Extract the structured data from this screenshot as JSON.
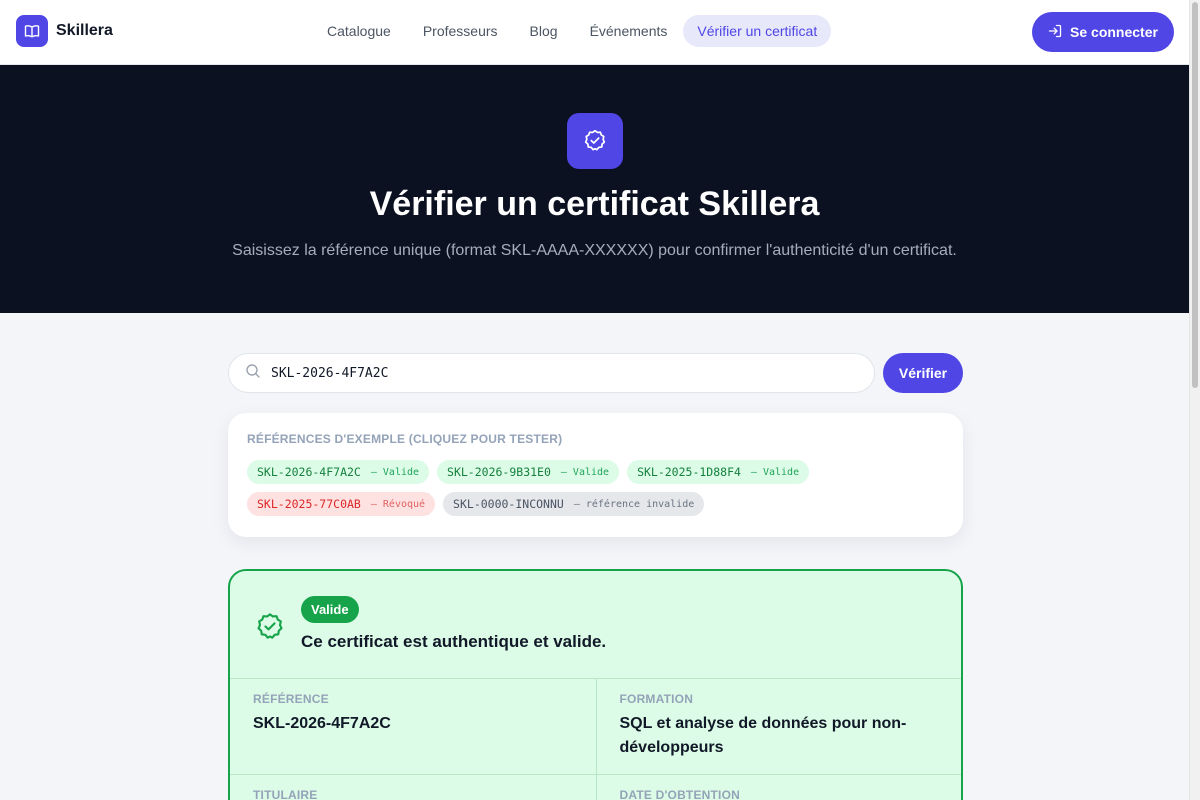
{
  "header": {
    "brand": "Skillera",
    "nav": [
      {
        "label": "Catalogue"
      },
      {
        "label": "Professeurs"
      },
      {
        "label": "Blog"
      },
      {
        "label": "Événements"
      },
      {
        "label": "Vérifier un certificat",
        "active": true
      }
    ],
    "login_label": "Se connecter"
  },
  "hero": {
    "title": "Vérifier un certificat Skillera",
    "subtitle": "Saisissez la référence unique (format SKL-AAAA-XXXXXX) pour confirmer l'authenticité d'un certificat."
  },
  "search": {
    "value": "SKL-2026-4F7A2C",
    "button_label": "Vérifier"
  },
  "examples": {
    "title": "RÉFÉRENCES D'EXEMPLE (CLIQUEZ POUR TESTER)",
    "items": [
      {
        "ref": "SKL-2026-4F7A2C",
        "status": "— Valide",
        "tone": "green"
      },
      {
        "ref": "SKL-2026-9B31E0",
        "status": "— Valide",
        "tone": "green"
      },
      {
        "ref": "SKL-2025-1D88F4",
        "status": "— Valide",
        "tone": "green"
      },
      {
        "ref": "SKL-2025-77C0AB",
        "status": "— Révoqué",
        "tone": "red"
      },
      {
        "ref": "SKL-0000-INCONNU",
        "status": "— référence invalide",
        "tone": "gray"
      }
    ]
  },
  "result": {
    "status": "Valide",
    "message": "Ce certificat est authentique et valide.",
    "fields": [
      {
        "label": "RÉFÉRENCE",
        "value": "SKL-2026-4F7A2C"
      },
      {
        "label": "FORMATION",
        "value": "SQL et analyse de données pour non-développeurs"
      },
      {
        "label": "TITULAIRE",
        "value": ""
      },
      {
        "label": "DATE D'OBTENTION",
        "value": ""
      }
    ]
  },
  "colors": {
    "accent": "#4f46e5",
    "hero_bg": "#0b1120",
    "success": "#16a34a",
    "success_bg": "#dcfce7",
    "danger": "#dc2626"
  }
}
